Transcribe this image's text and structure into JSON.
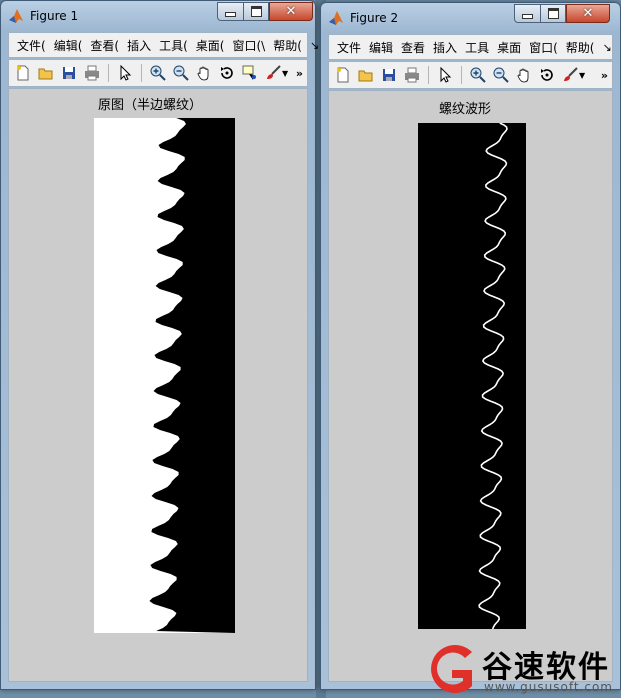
{
  "windows": [
    {
      "title": "Figure 1",
      "menus": [
        "文件(",
        "编辑(",
        "查看(",
        "插入",
        "工具(",
        "桌面(",
        "窗口(\\",
        "帮助("
      ],
      "menu_overflow": "↘",
      "toolbar_overflow": "»",
      "toolbar_icons": [
        "new-figure-icon",
        "open-file-icon",
        "save-icon",
        "print-icon",
        "select-arrow-icon",
        "zoom-in-icon",
        "zoom-out-icon",
        "pan-hand-icon",
        "rotate-3d-icon",
        "data-cursor-icon",
        "brush-icon"
      ],
      "axes_title": "原图（半边螺纹）",
      "image_desc_colors": {
        "background": "#ffffff",
        "foreground": "#000000"
      }
    },
    {
      "title": "Figure 2",
      "menus": [
        "文件",
        "编辑",
        "查看",
        "插入",
        "工具",
        "桌面",
        "窗口(",
        "帮助("
      ],
      "menu_overflow": "↘",
      "toolbar_overflow": "»",
      "toolbar_icons": [
        "new-figure-icon",
        "open-file-icon",
        "save-icon",
        "print-icon",
        "select-arrow-icon",
        "zoom-in-icon",
        "zoom-out-icon",
        "pan-hand-icon",
        "rotate-3d-icon",
        "brush-icon"
      ],
      "axes_title": "螺纹波形",
      "image_desc_colors": {
        "background": "#000000",
        "foreground": "#ffffff"
      }
    }
  ],
  "watermark": {
    "name": "谷速软件",
    "url": "www.gususoft.com",
    "brand_color": "#e0302a"
  }
}
